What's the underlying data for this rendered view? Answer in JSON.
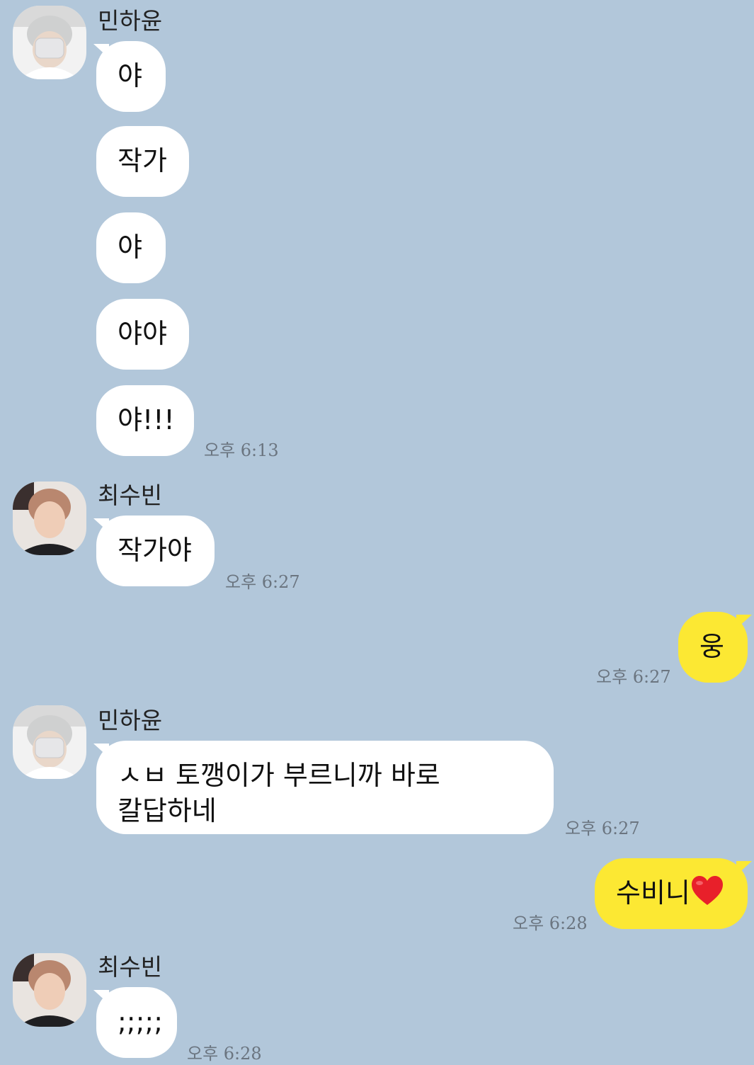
{
  "senders": {
    "a": "민하윤",
    "b": "최수빈"
  },
  "messages": [
    {
      "text": "야"
    },
    {
      "text": "작가"
    },
    {
      "text": "야"
    },
    {
      "text": "야야"
    },
    {
      "text": "야!!!",
      "time": "오후 6:13"
    },
    {
      "text": "작가야",
      "time": "오후 6:27"
    },
    {
      "text": "웅",
      "time": "오후 6:27"
    },
    {
      "line1": "ㅅㅂ 토깽이가 부르니까 바로",
      "line2": "칼답하네",
      "time": "오후 6:27"
    },
    {
      "text": "수비니",
      "time": "오후 6:28",
      "icon": "heart-icon"
    },
    {
      "text": ";;;;;",
      "time": "오후 6:28"
    }
  ],
  "colors": {
    "background": "#b2c7da",
    "incoming_bubble": "#ffffff",
    "outgoing_bubble": "#fce833",
    "heart": "#e8202a"
  }
}
